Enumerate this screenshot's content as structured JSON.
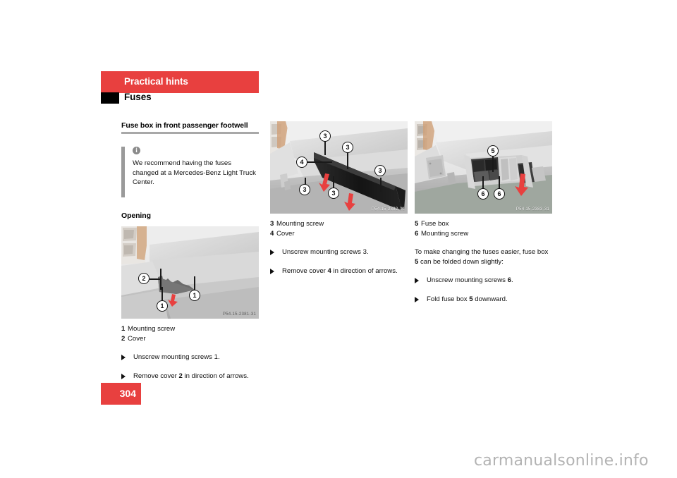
{
  "header": {
    "chapter": "Practical hints",
    "section": "Fuses"
  },
  "column1": {
    "heading": "Fuse box in front passenger footwell",
    "note": {
      "icon": "info-icon",
      "text": "We recommend having the fuses changed at a Mercedes-Benz Light Truck Center."
    },
    "block_heading": "Opening",
    "figure": {
      "code": "P54.15-2381-31",
      "callouts": [
        "2",
        "1",
        "1"
      ]
    },
    "legend": [
      {
        "num": "1",
        "label": "Mounting screw"
      },
      {
        "num": "2",
        "label": "Cover"
      }
    ],
    "steps": [
      {
        "pre": "Unscrew mounting screws 1.",
        "bold": "",
        "post": ""
      },
      {
        "pre": "Remove cover ",
        "bold": "2",
        "post": " in direction of arrows."
      }
    ]
  },
  "column2": {
    "figure": {
      "code": "P54.15-2382-31",
      "callouts": [
        "3",
        "3",
        "4",
        "3",
        "3",
        "3"
      ]
    },
    "legend": [
      {
        "num": "3",
        "label": "Mounting screw"
      },
      {
        "num": "4",
        "label": "Cover"
      }
    ],
    "steps": [
      {
        "pre": "Unscrew mounting screws 3.",
        "bold": "",
        "post": ""
      },
      {
        "pre": "Remove cover ",
        "bold": "4",
        "post": " in direction of arrows."
      }
    ]
  },
  "column3": {
    "figure": {
      "code": "P54.15-2383-31",
      "callouts": [
        "5",
        "6",
        "6"
      ]
    },
    "legend": [
      {
        "num": "5",
        "label": "Fuse box"
      },
      {
        "num": "6",
        "label": "Mounting screw"
      }
    ],
    "paragraph_pre": "To make changing the fuses easier, fuse box ",
    "paragraph_bold": "5",
    "paragraph_post": " can be folded down slightly:",
    "steps": [
      {
        "pre": "Unscrew mounting screws ",
        "bold": "6",
        "post": "."
      },
      {
        "pre": "Fold fuse box ",
        "bold": "5",
        "post": " downward."
      }
    ]
  },
  "footer": {
    "page_number": "304",
    "watermark": "carmanualsonline.info"
  },
  "colors": {
    "accent_red": "#e8403f",
    "rule_gray": "#a8a8a8",
    "note_bar_gray": "#9a9a9a"
  }
}
